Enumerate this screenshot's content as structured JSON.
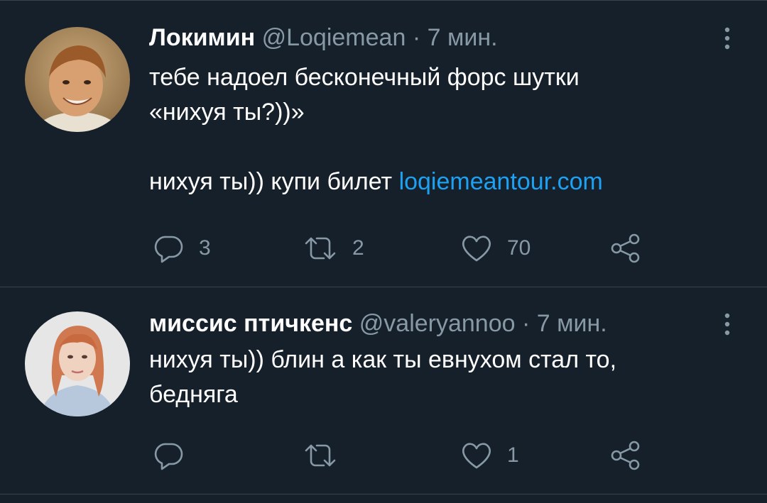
{
  "tweets": [
    {
      "display_name": "Локимин",
      "handle": "@Loqiemean",
      "separator": "·",
      "time": "7 мин.",
      "body_lines": [
        "тебе надоел бесконечный форс шутки",
        "«нихуя ты?))»",
        "",
        "нихуя ты)) купи билет"
      ],
      "link": "loqiemeantour.com",
      "reply_count": "3",
      "retweet_count": "2",
      "like_count": "70",
      "avatar_icon": "child-photo-avatar"
    },
    {
      "display_name": "миссис птичкенс",
      "handle": "@valeryannoo",
      "separator": "·",
      "time": "7 мин.",
      "body_lines": [
        "нихуя ты)) блин а как ты евнухом стал то,",
        "бедняга"
      ],
      "reply_count": "",
      "retweet_count": "",
      "like_count": "1",
      "avatar_icon": "woman-photo-avatar"
    }
  ],
  "icons": {
    "reply": "reply-icon",
    "retweet": "retweet-icon",
    "like": "like-icon",
    "share": "share-icon",
    "more": "more-options-icon"
  },
  "colors": {
    "background": "#15202b",
    "divider": "#38444d",
    "text": "#ffffff",
    "secondary": "#8899a6",
    "link": "#1da1f2"
  }
}
